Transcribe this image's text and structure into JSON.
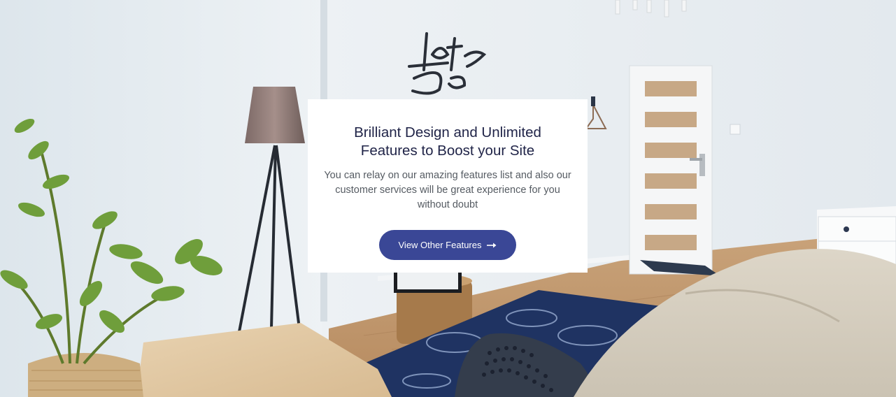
{
  "background": {
    "wall_art_text": "Lets Do",
    "description_icon": "bedroom-photo"
  },
  "card": {
    "title": "Brilliant Design and Unlimited Features to Boost your Site",
    "body": "You can relay on our amazing features list and also our customer services will be great experience for you without doubt",
    "button_label": "View Other Features",
    "button_icon": "arrow-right-icon",
    "accent_color": "#3a4796"
  }
}
